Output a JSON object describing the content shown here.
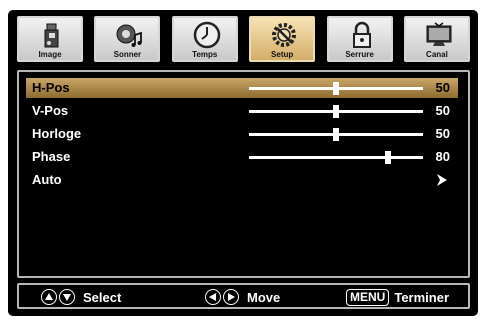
{
  "tabs": [
    {
      "label": "Image",
      "icon": "camera-icon",
      "active": false
    },
    {
      "label": "Sonner",
      "icon": "speaker-icon",
      "active": false
    },
    {
      "label": "Temps",
      "icon": "clock-icon",
      "active": false
    },
    {
      "label": "Setup",
      "icon": "gear-icon",
      "active": true
    },
    {
      "label": "Serrure",
      "icon": "lock-icon",
      "active": false
    },
    {
      "label": "Canal",
      "icon": "tv-icon",
      "active": false
    }
  ],
  "settings": [
    {
      "label": "H-Pos",
      "value": "50",
      "level": 0.5,
      "active": true
    },
    {
      "label": "V-Pos",
      "value": "50",
      "level": 0.5,
      "active": false
    },
    {
      "label": "Horloge",
      "value": "50",
      "level": 0.5,
      "active": false
    },
    {
      "label": "Phase",
      "value": "80",
      "level": 0.8,
      "active": false
    },
    {
      "label": "Auto",
      "arrow_icon": "arrow-right-icon",
      "active": false
    }
  ],
  "footer": {
    "select_label": "Select",
    "move_label": "Move",
    "menu_key": "MENU",
    "exit_label": "Terminer"
  },
  "colors": {
    "active_highlight": "#b8935a",
    "active_tab": "#e9cd8f",
    "background": "#000000"
  }
}
